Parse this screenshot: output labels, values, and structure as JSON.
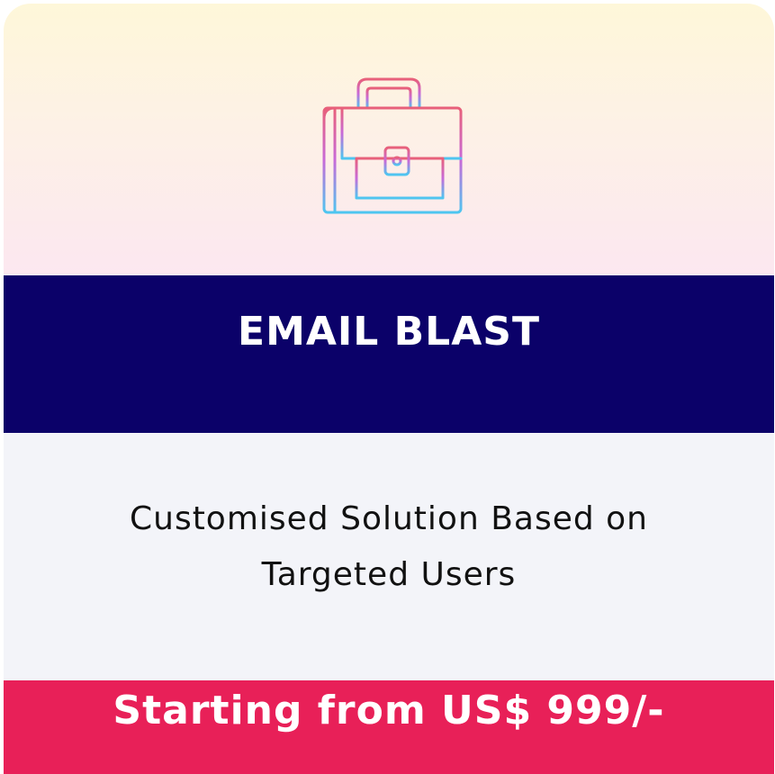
{
  "card": {
    "icon": "briefcase-icon",
    "title": "EMAIL BLAST",
    "description": "Customised Solution Based on Targeted Users",
    "price": "Starting from US$ 999/-"
  },
  "colors": {
    "title_band": "#0b0169",
    "price_band": "#e82058",
    "description_bg": "#f3f4f9",
    "icon_gradient_top": "#e8607a",
    "icon_gradient_mid": "#c86ad8",
    "icon_gradient_bottom": "#4ec6f0"
  }
}
